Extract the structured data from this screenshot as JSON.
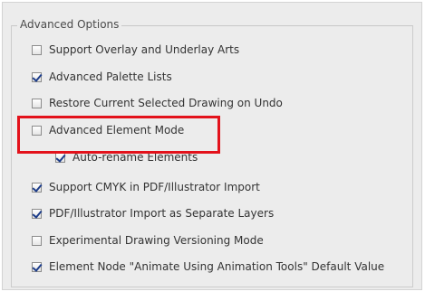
{
  "group": {
    "title": "Advanced Options"
  },
  "options": [
    {
      "label": "Support Overlay and Underlay Arts",
      "checked": false
    },
    {
      "label": "Advanced Palette Lists",
      "checked": true
    },
    {
      "label": "Restore Current Selected Drawing on Undo",
      "checked": false
    },
    {
      "label": "Advanced Element Mode",
      "checked": false,
      "highlighted": true
    },
    {
      "label": "Auto-rename Elements",
      "checked": true
    },
    {
      "label": "Support CMYK in PDF/Illustrator Import",
      "checked": true
    },
    {
      "label": "PDF/Illustrator Import as Separate Layers",
      "checked": true
    },
    {
      "label": "Experimental Drawing Versioning Mode",
      "checked": false
    },
    {
      "label": "Element Node \"Animate Using Animation Tools\" Default Value",
      "checked": true
    }
  ],
  "colors": {
    "highlight": "#e3121b",
    "check": "#1d3d8a",
    "panel": "#ececec"
  }
}
